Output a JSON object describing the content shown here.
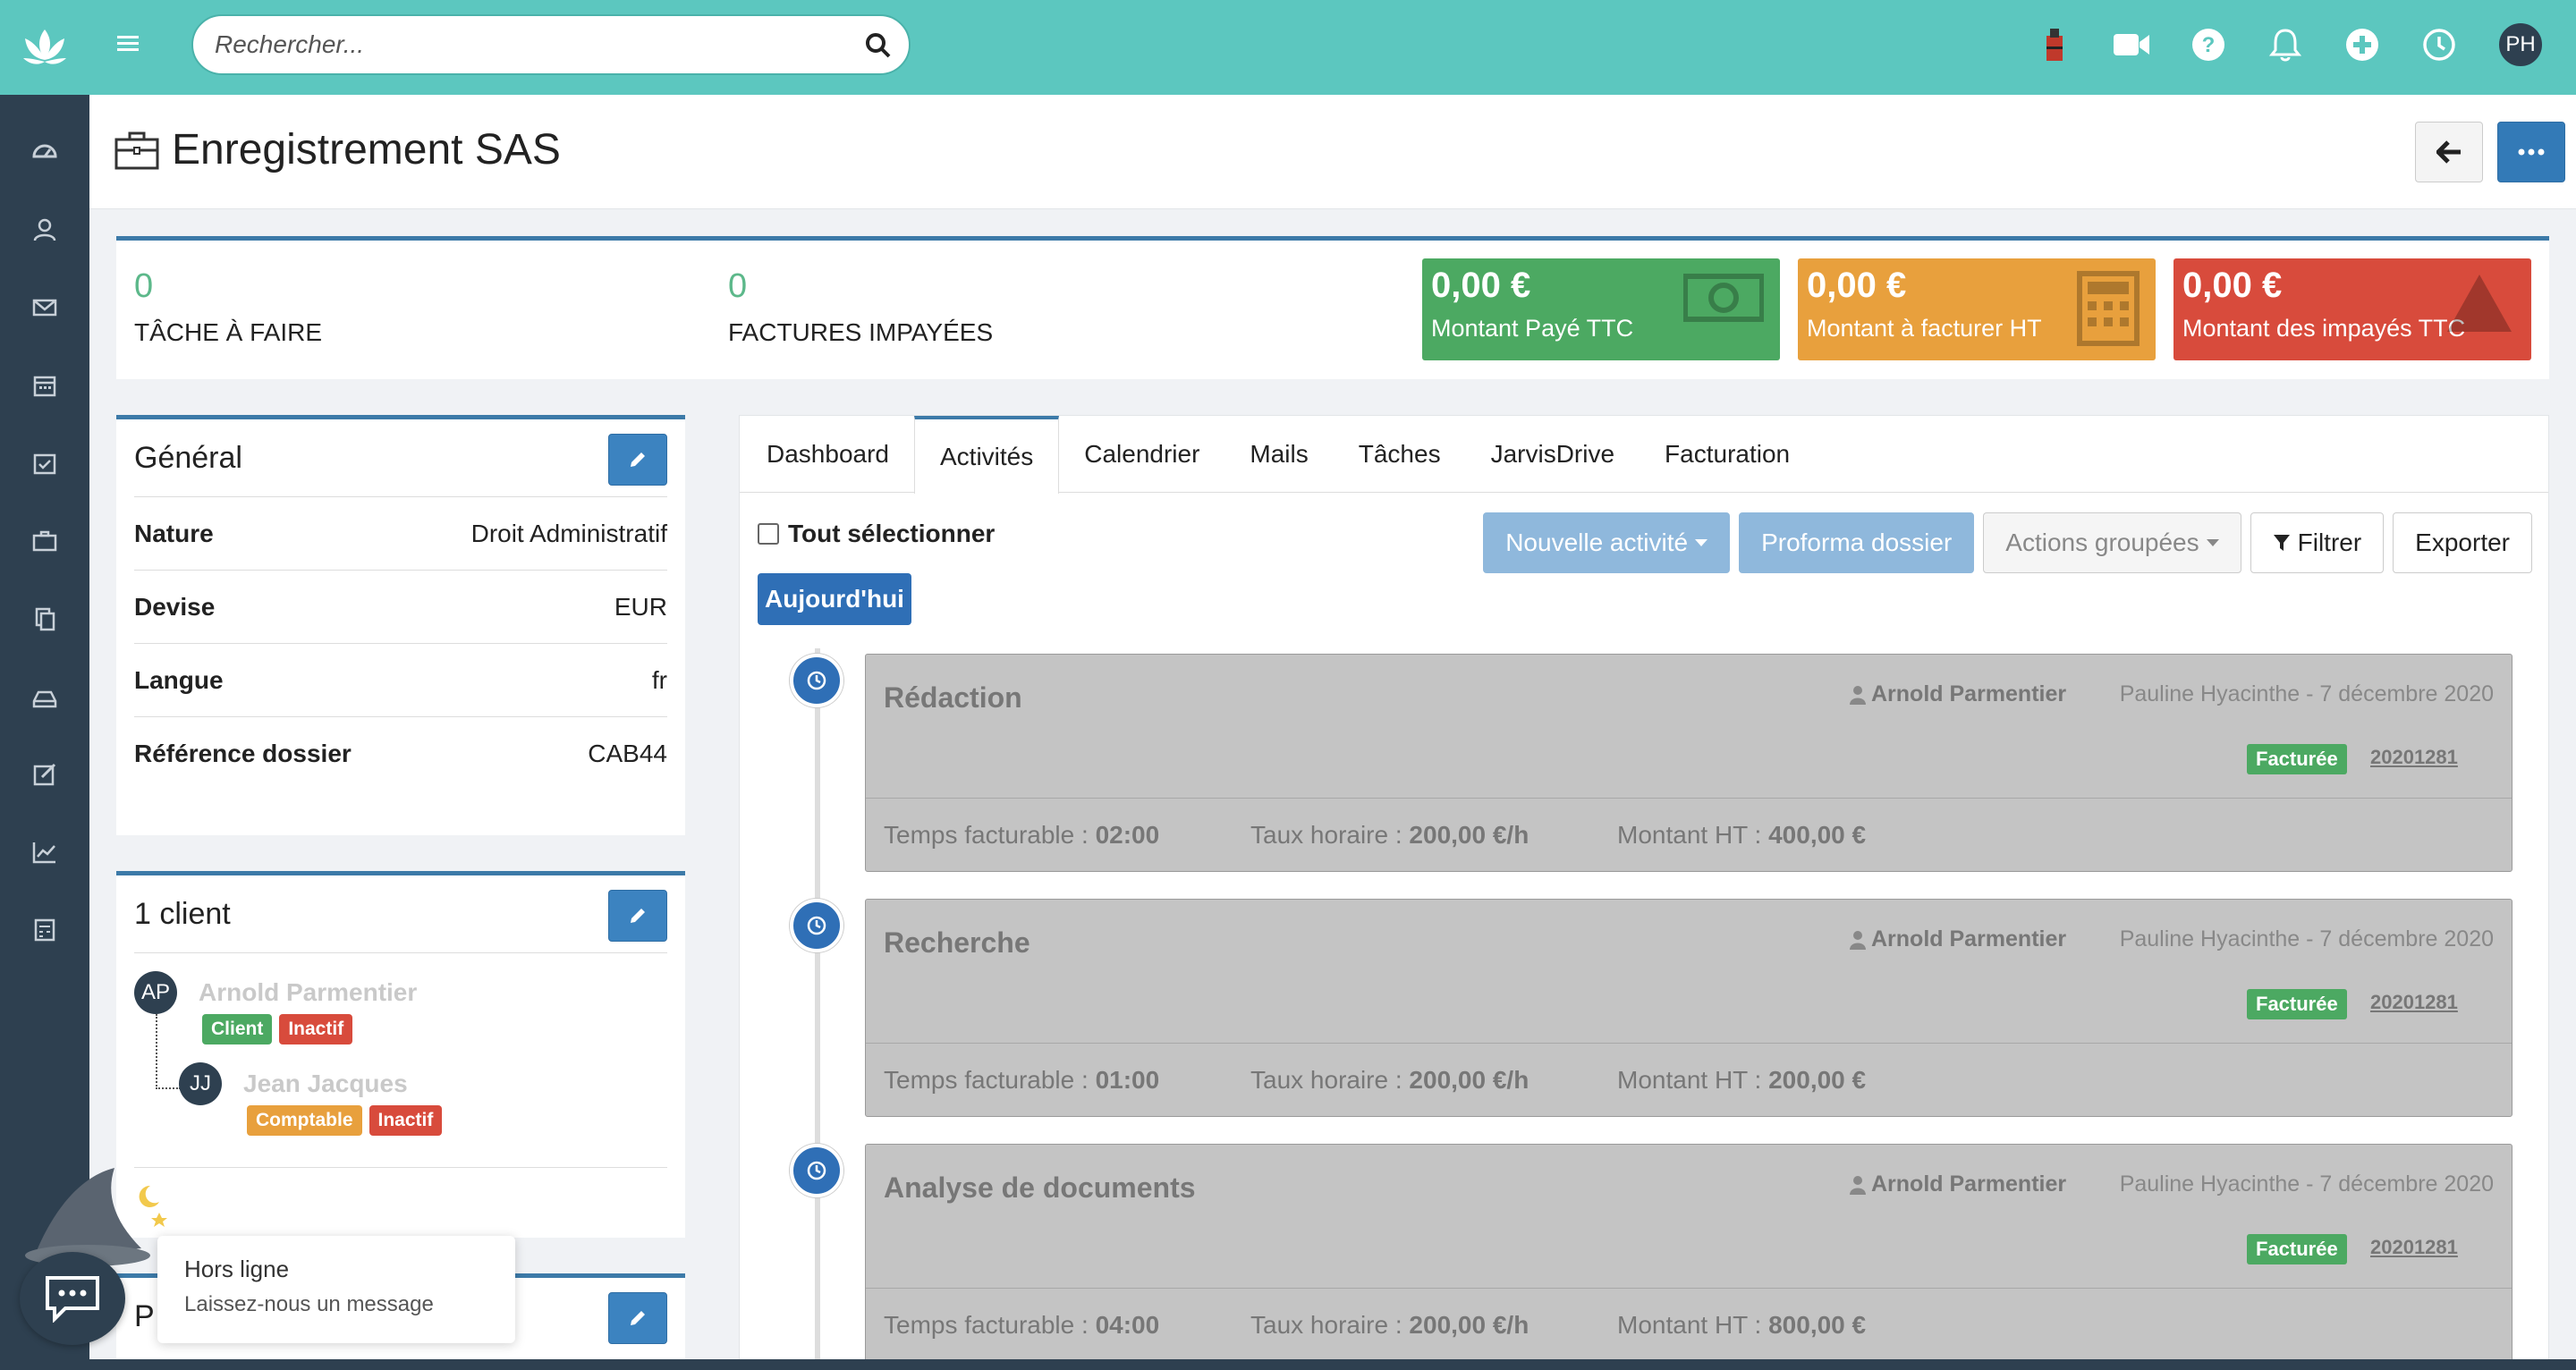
{
  "search": {
    "placeholder": "Rechercher..."
  },
  "user": {
    "initials": "PH"
  },
  "page": {
    "title": "Enregistrement SAS"
  },
  "stats": [
    {
      "value": "0",
      "label": "TÂCHE À FAIRE"
    },
    {
      "value": "0",
      "label": "FACTURES IMPAYÉES"
    }
  ],
  "cards": [
    {
      "amount": "0,00 €",
      "label": "Montant Payé TTC"
    },
    {
      "amount": "0,00 €",
      "label": "Montant à facturer HT"
    },
    {
      "amount": "0,00 €",
      "label": "Montant des impayés TTC"
    }
  ],
  "general": {
    "title": "Général",
    "rows": [
      {
        "key": "Nature",
        "value": "Droit Administratif"
      },
      {
        "key": "Devise",
        "value": "EUR"
      },
      {
        "key": "Langue",
        "value": "fr"
      },
      {
        "key": "Référence dossier",
        "value": "CAB44"
      }
    ]
  },
  "clients": {
    "title": "1 client",
    "items": [
      {
        "initials": "AP",
        "name": "Arnold Parmentier",
        "badges": [
          "Client",
          "Inactif"
        ]
      },
      {
        "initials": "JJ",
        "name": "Jean Jacques",
        "badges": [
          "Comptable",
          "Inactif"
        ]
      }
    ]
  },
  "third_panel": {
    "title_fragment": "P"
  },
  "tabs": [
    "Dashboard",
    "Activités",
    "Calendrier",
    "Mails",
    "Tâches",
    "JarvisDrive",
    "Facturation"
  ],
  "toolbar": {
    "select_all": "Tout sélectionner",
    "today": "Aujourd'hui",
    "new_activity": "Nouvelle activité",
    "proforma": "Proforma dossier",
    "grouped_actions": "Actions groupées",
    "filter": "Filtrer",
    "export": "Exporter"
  },
  "activities": [
    {
      "title": "Rédaction",
      "user": "Arnold Parmentier",
      "meta": "Pauline Hyacinthe - 7 décembre 2020",
      "status": "Facturée",
      "ref": "20201281",
      "time_label": "Temps facturable : ",
      "time": "02:00",
      "rate_label": "Taux horaire : ",
      "rate": "200,00 €/h",
      "amount_label": "Montant HT : ",
      "amount": "400,00 €"
    },
    {
      "title": "Recherche",
      "user": "Arnold Parmentier",
      "meta": "Pauline Hyacinthe - 7 décembre 2020",
      "status": "Facturée",
      "ref": "20201281",
      "time_label": "Temps facturable : ",
      "time": "01:00",
      "rate_label": "Taux horaire : ",
      "rate": "200,00 €/h",
      "amount_label": "Montant HT : ",
      "amount": "200,00 €"
    },
    {
      "title": "Analyse de documents",
      "user": "Arnold Parmentier",
      "meta": "Pauline Hyacinthe - 7 décembre 2020",
      "status": "Facturée",
      "ref": "20201281",
      "time_label": "Temps facturable : ",
      "time": "04:00",
      "rate_label": "Taux horaire : ",
      "rate": "200,00 €/h",
      "amount_label": "Montant HT : ",
      "amount": "800,00 €"
    }
  ],
  "chat": {
    "status": "Hors ligne",
    "message": "Laissez-nous un message"
  },
  "colors": {
    "topbar": "#5cc7bf",
    "sidebar": "#2e4050",
    "primary": "#337ab7",
    "success": "#4ca962",
    "warning": "#e8a03d",
    "danger": "#d84b3c"
  },
  "icons": {
    "sidebar": [
      "dashboard-icon",
      "contacts-icon",
      "mail-icon",
      "calendar-icon",
      "tasks-icon",
      "briefcase-icon",
      "documents-icon",
      "inbox-icon",
      "edit-icon",
      "chart-icon",
      "calculator-icon"
    ],
    "topbar": [
      "extension-icon",
      "video-icon",
      "help-icon",
      "bell-icon",
      "plus-circle-icon",
      "clock-icon"
    ]
  }
}
